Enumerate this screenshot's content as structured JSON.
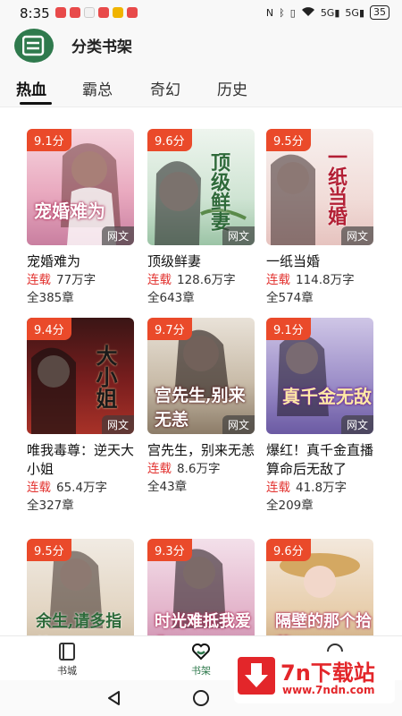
{
  "status_bar": {
    "time": "8:35",
    "signal_a": "5G",
    "signal_b": "5G",
    "battery": "35"
  },
  "app_bar": {
    "title": "分类书架"
  },
  "tabs": [
    {
      "label": "热血",
      "active": true
    },
    {
      "label": "霸总",
      "active": false
    },
    {
      "label": "奇幻",
      "active": false
    },
    {
      "label": "历史",
      "active": false
    }
  ],
  "books": [
    {
      "score": "9.1分",
      "tag": "网文",
      "cover_text": "宠婚难为",
      "title": "宠婚难为",
      "status": "连载",
      "words": "77万字",
      "chapters": "全385章"
    },
    {
      "score": "9.6分",
      "tag": "网文",
      "cover_text": "顶级鲜妻",
      "title": "顶级鲜妻",
      "status": "连载",
      "words": "128.6万字",
      "chapters": "全643章"
    },
    {
      "score": "9.5分",
      "tag": "网文",
      "cover_text": "一纸当婚",
      "title": "一纸当婚",
      "status": "连载",
      "words": "114.8万字",
      "chapters": "全574章"
    },
    {
      "score": "9.4分",
      "tag": "网文",
      "cover_text": "大小姐",
      "title": "唯我毒尊：逆天大小姐",
      "status": "连载",
      "words": "65.4万字",
      "chapters": "全327章"
    },
    {
      "score": "9.7分",
      "tag": "网文",
      "cover_text": "宫先生,别来无恙",
      "title": "宫先生，别来无恙",
      "status": "连载",
      "words": "8.6万字",
      "chapters": "全43章"
    },
    {
      "score": "9.1分",
      "tag": "网文",
      "cover_text": "真千金无敌",
      "title": "爆红！真千金直播算命后无敌了",
      "status": "连载",
      "words": "41.8万字",
      "chapters": "全209章"
    },
    {
      "score": "9.5分",
      "tag": "",
      "cover_text": "余生,请多指教",
      "title": "",
      "status": "",
      "words": "",
      "chapters": ""
    },
    {
      "score": "9.3分",
      "tag": "",
      "cover_text": "时光难抵我爱你",
      "title": "",
      "status": "",
      "words": "",
      "chapters": ""
    },
    {
      "score": "9.6分",
      "tag": "",
      "cover_text": "隔壁的那个拾荒",
      "title": "",
      "status": "",
      "words": "",
      "chapters": ""
    }
  ],
  "bottom_nav": [
    {
      "label": "书城",
      "icon": "book-city-icon",
      "active": false
    },
    {
      "label": "书架",
      "icon": "heart-icon",
      "active": true
    },
    {
      "label": "",
      "icon": "profile-icon",
      "active": false
    }
  ],
  "watermark": {
    "brand": "7n下载站",
    "url": "www.7ndn.com"
  },
  "colors": {
    "accent": "#2f7a4d",
    "score_badge": "#ea4a2a",
    "status_text": "#e2302d"
  }
}
